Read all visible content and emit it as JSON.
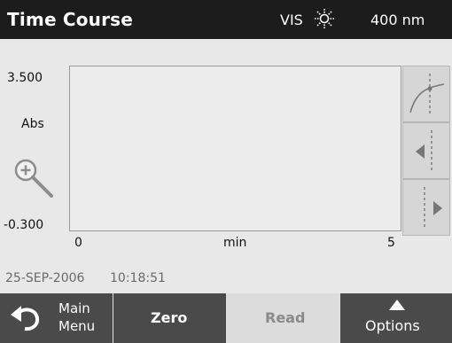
{
  "header": {
    "title": "Time Course",
    "mode": "VIS",
    "lamp_icon": "sun-lamp-icon",
    "wavelength": "400 nm"
  },
  "graph": {
    "y_max": "3.500",
    "y_unit": "Abs",
    "y_min": "-0.300",
    "x_min": "0",
    "x_unit": "min",
    "x_max": "5"
  },
  "side_buttons": [
    {
      "icon": "curve-cursor-icon"
    },
    {
      "icon": "cursor-left-icon"
    },
    {
      "icon": "cursor-right-icon"
    }
  ],
  "status": {
    "date": "25-SEP-2006",
    "time": "10:18:51"
  },
  "bottom": {
    "main_menu_line1": "Main",
    "main_menu_line2": "Menu",
    "zero": "Zero",
    "read": "Read",
    "options": "Options"
  },
  "colors": {
    "header_bg": "#1c1c1c",
    "button_dark": "#4a4a4a",
    "button_disabled": "#dcdcdc"
  }
}
